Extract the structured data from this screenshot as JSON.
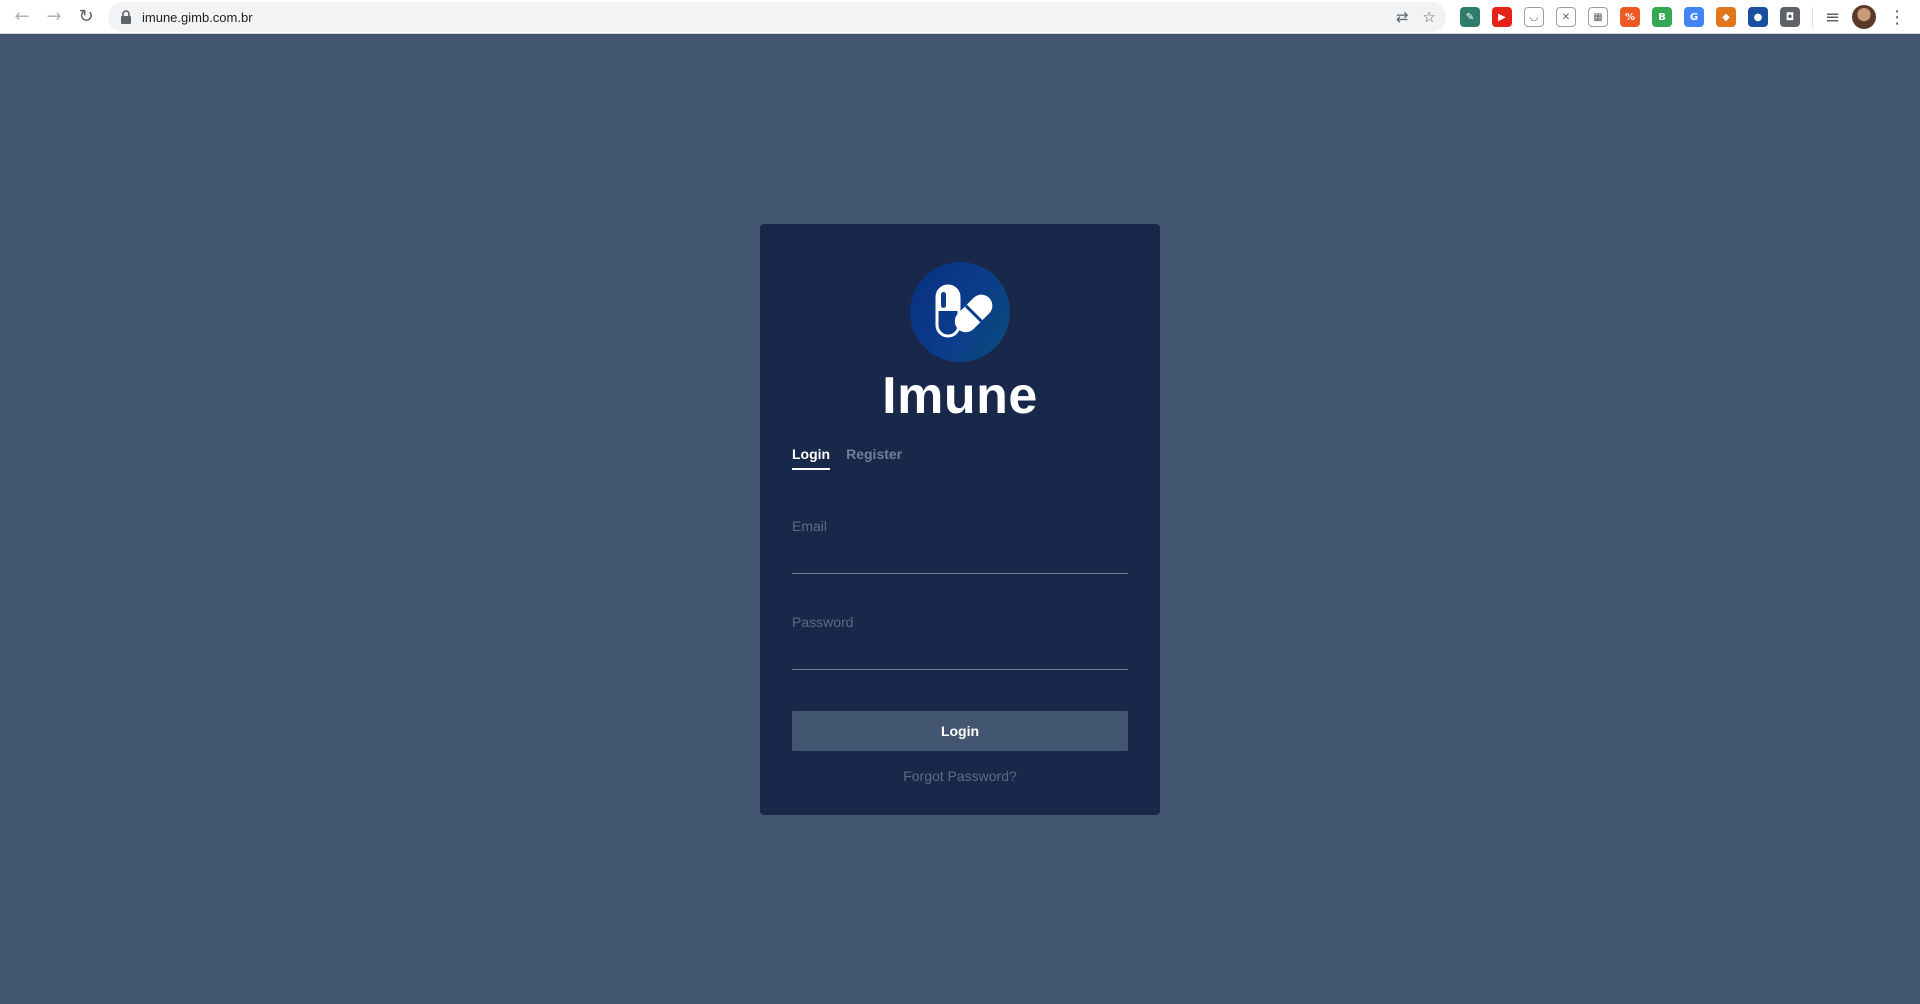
{
  "browser": {
    "url": "imune.gimb.com.br",
    "extensions": [
      {
        "name": "eyedropper-extension-icon",
        "color": "#2e7d6b",
        "glyph": "✎"
      },
      {
        "name": "youtube-extension-icon",
        "color": "#e62117",
        "glyph": "▶"
      },
      {
        "name": "pocket-extension-icon",
        "color": "#ffffff",
        "glyph": "◡"
      },
      {
        "name": "tools-extension-icon",
        "color": "#ffffff",
        "glyph": "✕"
      },
      {
        "name": "grid-extension-icon",
        "color": "#ffffff",
        "glyph": "▦"
      },
      {
        "name": "percent-extension-icon",
        "color": "#ef5a24",
        "glyph": "%"
      },
      {
        "name": "b-plus-extension-icon",
        "color": "#34a853",
        "glyph": "B"
      },
      {
        "name": "translate-extension-icon",
        "color": "#4285f4",
        "glyph": "G"
      },
      {
        "name": "metamask-extension-icon",
        "color": "#e2761b",
        "glyph": "◆"
      },
      {
        "name": "globe-extension-icon",
        "color": "#1a4fa0",
        "glyph": "●"
      },
      {
        "name": "shield-extension-icon",
        "color": "#5f6368",
        "glyph": "◘"
      }
    ]
  },
  "app": {
    "name": "Imune",
    "tabs": {
      "login": "Login",
      "register": "Register"
    },
    "email_label": "Email",
    "password_label": "Password",
    "login_button": "Login",
    "forgot_password": "Forgot Password?"
  },
  "colors": {
    "page_background": "#425672",
    "card_background": "#17284a",
    "button_background": "#425672"
  }
}
